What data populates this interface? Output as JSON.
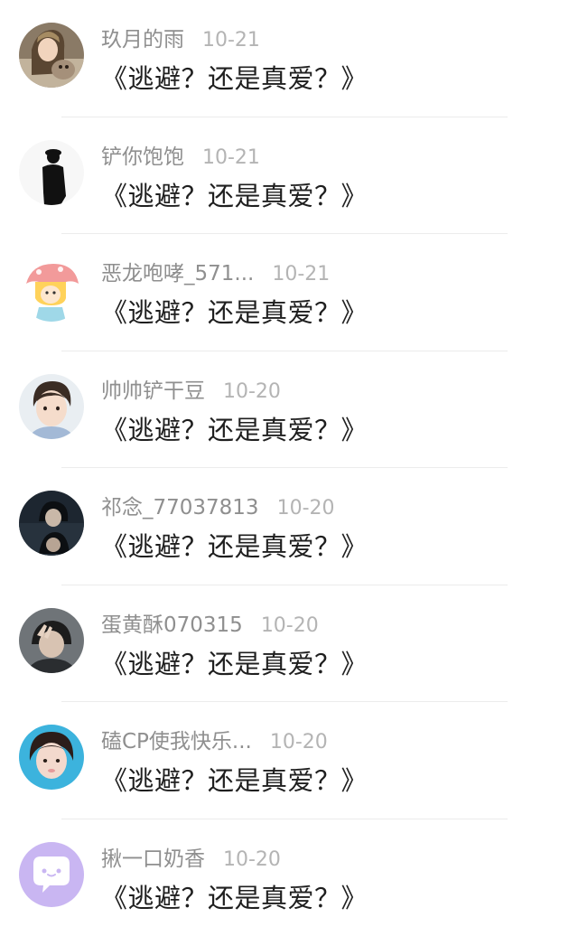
{
  "comments": [
    {
      "username": "玖月的雨",
      "date": "10-21",
      "text": "《逃避？还是真爱？》",
      "avatar": "avatar-girl-with-dog"
    },
    {
      "username": "铲你饱饱",
      "date": "10-21",
      "text": "《逃避？还是真爱？》",
      "avatar": "avatar-silhouette"
    },
    {
      "username": "恶龙咆哮_571...",
      "date": "10-21",
      "text": "《逃避？还是真爱？》",
      "avatar": "avatar-cartoon-girl"
    },
    {
      "username": "帅帅铲干豆",
      "date": "10-20",
      "text": "《逃避？还是真爱？》",
      "avatar": "avatar-boy-portrait"
    },
    {
      "username": "祁念_77037813",
      "date": "10-20",
      "text": "《逃避？还是真爱？》",
      "avatar": "avatar-dark-portrait"
    },
    {
      "username": "蛋黄酥070315",
      "date": "10-20",
      "text": "《逃避？还是真爱？》",
      "avatar": "avatar-peace-sign"
    },
    {
      "username": "磕CP使我快乐...",
      "date": "10-20",
      "text": "《逃避？还是真爱？》",
      "avatar": "avatar-girl-blue"
    },
    {
      "username": "揪一口奶香",
      "date": "10-20",
      "text": "《逃避？还是真爱？》",
      "avatar": "avatar-chat-bubble-default"
    }
  ],
  "colors": {
    "username": "#8f8f8f",
    "date": "#b4b4b4",
    "content": "#1f1f1f",
    "divider": "#ececec",
    "default_avatar": "#c9b6f2"
  }
}
